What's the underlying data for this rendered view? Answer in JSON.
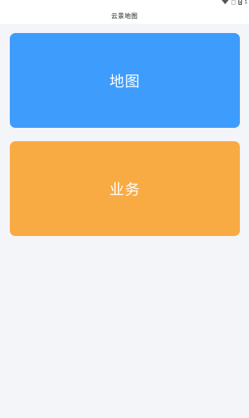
{
  "status_bar": {
    "time": "1",
    "icons": [
      "wifi-icon",
      "sim-icon",
      "battery-icon"
    ]
  },
  "header": {
    "title": "云景地图"
  },
  "tiles": [
    {
      "label": "地图",
      "color": "#3e9cfd"
    },
    {
      "label": "业务",
      "color": "#f9ab43"
    }
  ],
  "colors": {
    "background": "#f4f5f9",
    "header_background": "#ffffff"
  }
}
